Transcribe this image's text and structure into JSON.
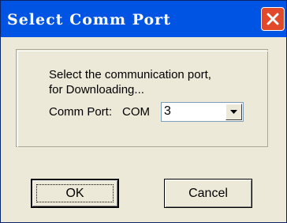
{
  "window": {
    "title": "Select Comm Port"
  },
  "group": {
    "prompt_line1": "Select the communication port,",
    "prompt_line2": "for Downloading...",
    "comm_label": "Comm Port:",
    "com_prefix": "COM",
    "port_select": {
      "selected": "3"
    }
  },
  "buttons": {
    "ok_label": "OK",
    "cancel_label": "Cancel"
  },
  "icons": {
    "close": "close-icon",
    "dropdown": "chevron-down-icon"
  },
  "colors": {
    "titlebar": "#0054e3",
    "close_button": "#e04a2a",
    "dialog_background": "#ece9d8"
  }
}
